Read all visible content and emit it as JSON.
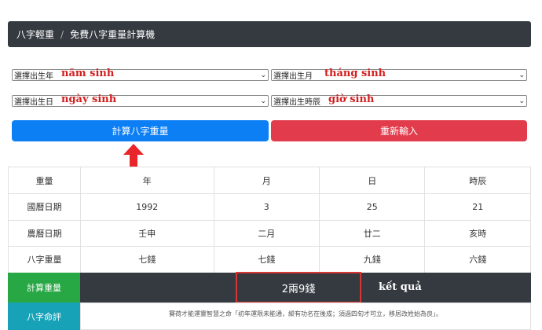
{
  "breadcrumb": {
    "home": "八字輕重",
    "separator": "/",
    "current": "免費八字重量計算機"
  },
  "form": {
    "year": {
      "label": "選擇出生年",
      "annotation": "năm sinh"
    },
    "month": {
      "label": "選擇出生月",
      "annotation": "tháng sinh"
    },
    "day": {
      "label": "選擇出生日",
      "annotation": "ngày sinh"
    },
    "hour": {
      "label": "選擇出生時辰",
      "annotation": "giờ sinh"
    }
  },
  "buttons": {
    "calculate": "計算八字重量",
    "reset": "重新輸入"
  },
  "table": {
    "headers": [
      "重量",
      "年",
      "月",
      "日",
      "時辰"
    ],
    "rows": [
      [
        "國曆日期",
        "1992",
        "3",
        "25",
        "21"
      ],
      [
        "農曆日期",
        "壬申",
        "二月",
        "廿二",
        "亥時"
      ],
      [
        "八字重量",
        "七錢",
        "七錢",
        "九錢",
        "六錢"
      ]
    ]
  },
  "result": {
    "label": "計算重量",
    "value": "2兩9錢",
    "annotation": "kết quả"
  },
  "fate": {
    "label": "八字命評",
    "text": "賽荷才能運靈智慧之命「初年運限未能通，縱有功名在後成；須過四旬才可立，移居改姓始為良」。"
  },
  "colors": {
    "primary": "#0d7ff5",
    "danger": "#e23c4c",
    "success": "#28a745",
    "info": "#17a2b8",
    "dark": "#343a40",
    "annotation": "#d11f1f"
  }
}
